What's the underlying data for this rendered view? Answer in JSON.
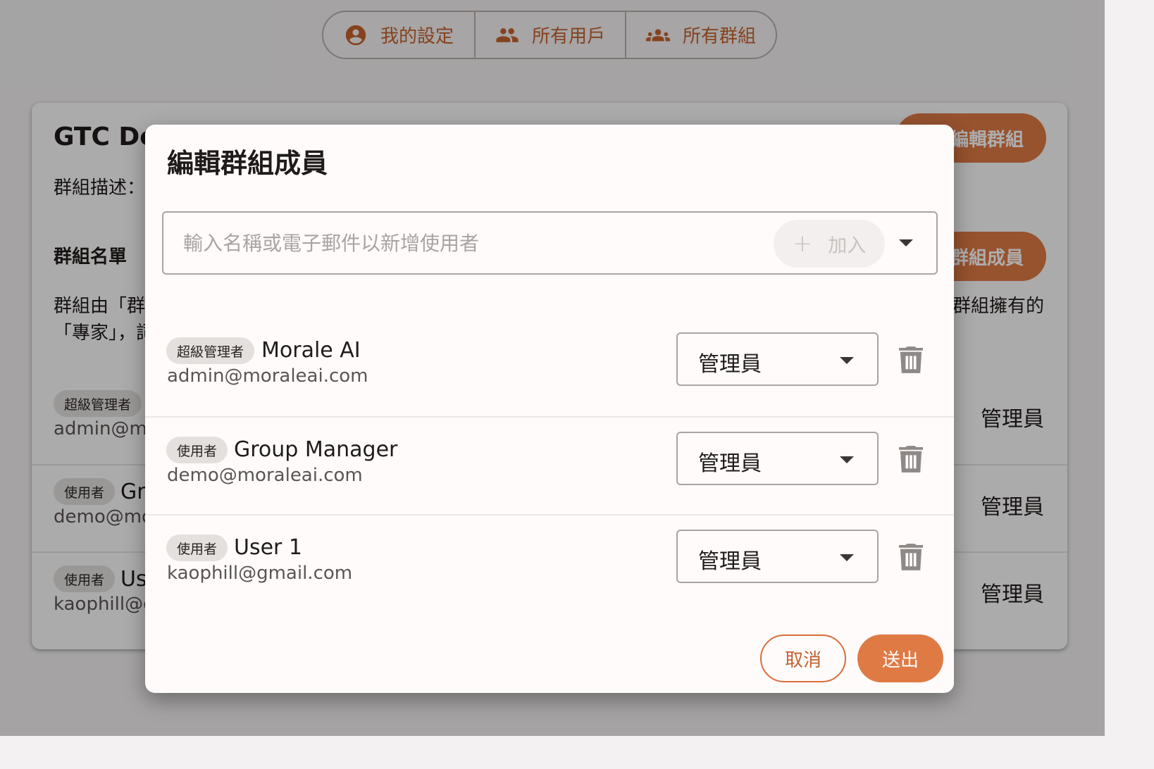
{
  "nav": {
    "items": [
      {
        "label": "我的設定",
        "icon": "account-circle-icon"
      },
      {
        "label": "所有用戶",
        "icon": "people-icon"
      },
      {
        "label": "所有群組",
        "icon": "groups-icon"
      }
    ]
  },
  "card": {
    "title": "GTC De",
    "description_label": "群組描述：",
    "roster_heading": "群組名單",
    "note_line1": "群組由「群",
    "note_line2": "「專家」，詞",
    "note_right": "群組擁有的",
    "edit_group_label": "編輯群組",
    "edit_members_label": "群組成員",
    "rows": [
      {
        "chip": "超級管理者",
        "name": "",
        "email": "admin@mo",
        "role": "管理員"
      },
      {
        "chip": "使用者",
        "name": "Gr",
        "email": "demo@mo",
        "role": "管理員"
      },
      {
        "chip": "使用者",
        "name": "Us",
        "email": "kaophill@g",
        "role": "管理員"
      }
    ]
  },
  "dialog": {
    "title": "編輯群組成員",
    "search": {
      "placeholder": "輸入名稱或電子郵件以新增使用者",
      "value": "",
      "add_label": "加入",
      "add_icon": "+"
    },
    "members": [
      {
        "chip": "超級管理者",
        "name": "Morale AI",
        "email": "admin@moraleai.com",
        "role": "管理員"
      },
      {
        "chip": "使用者",
        "name": "Group Manager",
        "email": "demo@moraleai.com",
        "role": "管理員"
      },
      {
        "chip": "使用者",
        "name": "User 1",
        "email": "kaophill@gmail.com",
        "role": "管理員"
      }
    ],
    "cancel_label": "取消",
    "submit_label": "送出"
  },
  "colors": {
    "accent": "#df7a45",
    "accent_text": "#c4622f",
    "scrim": "rgba(0,0,0,0.32)"
  }
}
